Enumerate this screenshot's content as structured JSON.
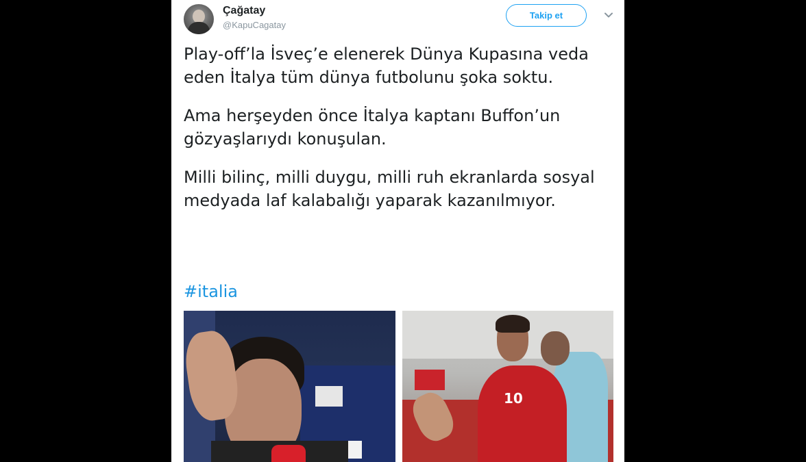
{
  "tweet": {
    "author": {
      "display_name": "Çağatay",
      "handle": "@KapuCagatay"
    },
    "follow_button_label": "Takip et",
    "paragraphs": [
      "Play-off’la İsveç’e elenerek Dünya Kupasına veda eden İtalya tüm dünya futbolunu şoka soktu.",
      "Ama herşeyden önce İtalya kaptanı Buffon’un gözyaşlarıydı konuşulan.",
      "Milli bilinç, milli duygu, milli ruh ekranlarda sosyal medyada laf kalabalığı yaparak kazanılmıyor."
    ],
    "hashtag": "#italia",
    "media": {
      "right_jersey_number": "10"
    }
  },
  "colors": {
    "background": "#000000",
    "card": "#ffffff",
    "text": "#1c2022",
    "secondary_text": "#8a969f",
    "link": "#1b95e0",
    "accent": "#1da1f2"
  },
  "icons": {
    "menu": "chevron-down-icon"
  }
}
